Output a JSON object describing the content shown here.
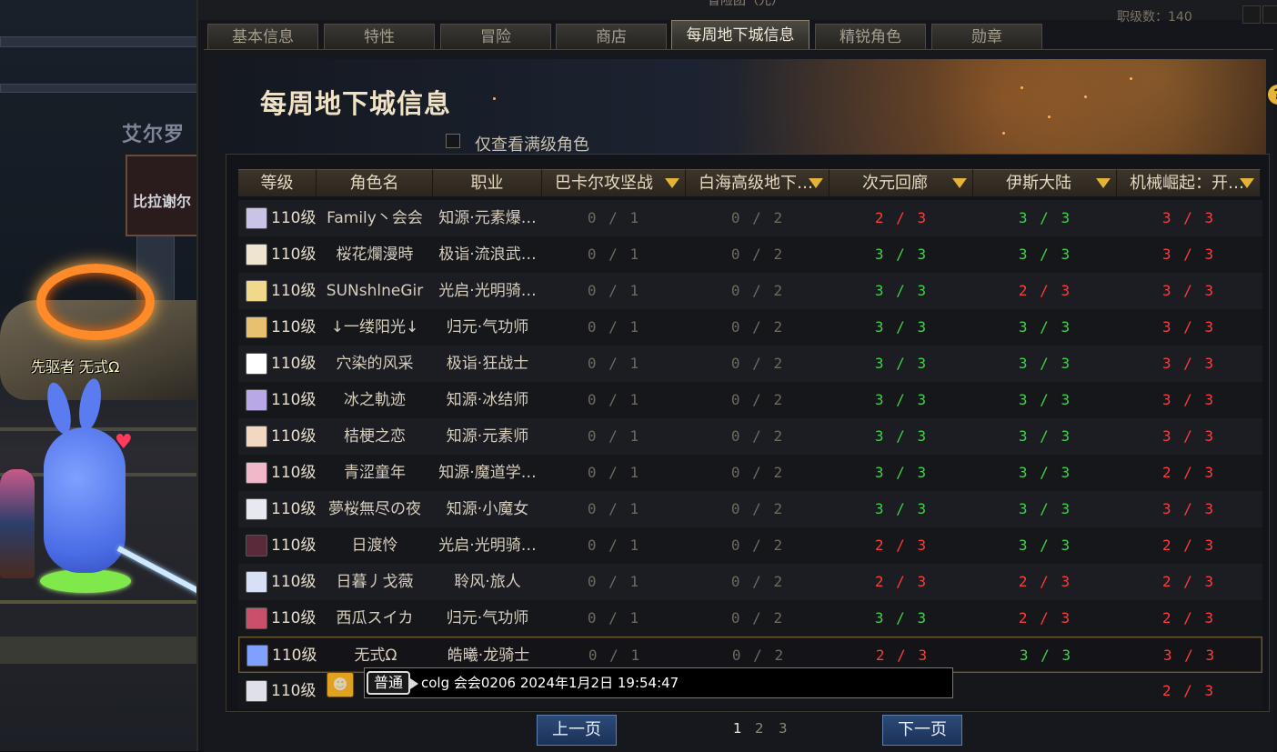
{
  "scene": {
    "wall_sign": "艾尔罗",
    "red_sign": "比拉谢尔",
    "player_name": "先驱者 无式Ω"
  },
  "window": {
    "title": "冒险团（光）",
    "counter": "职级数：140"
  },
  "tabs": [
    {
      "label": "基本信息"
    },
    {
      "label": "特性"
    },
    {
      "label": "冒险"
    },
    {
      "label": "商店"
    },
    {
      "label": "每周地下城信息",
      "active": true
    },
    {
      "label": "精锐角色"
    },
    {
      "label": "勋章"
    }
  ],
  "page": {
    "heading": "每周地下城信息",
    "filter_label": "仅查看满级角色",
    "help": "?"
  },
  "table": {
    "headers": {
      "level": "等级",
      "name": "角色名",
      "job": "职业",
      "d1": "巴卡尔攻坚战",
      "d2": "白海高级地下…",
      "d3": "次元回廊",
      "d4": "伊斯大陆",
      "d5": "机械崛起：开…"
    },
    "rows": [
      {
        "level": "110级",
        "name": "Family丶会会",
        "job": "知源·元素爆…",
        "d1": "0 / 1",
        "d2": "0 / 2",
        "d3": "2 / 3",
        "d4": "3 / 3",
        "d5": "3 / 3",
        "avatar": "#c9c3e8"
      },
      {
        "level": "110级",
        "name": "桜花爛漫時",
        "job": "极诣·流浪武…",
        "d1": "0 / 1",
        "d2": "0 / 2",
        "d3": "3 / 3",
        "d4": "3 / 3",
        "d5": "3 / 3",
        "avatar": "#efe4d0"
      },
      {
        "level": "110级",
        "name": "SUNshlneGir",
        "job": "光启·光明骑…",
        "d1": "0 / 1",
        "d2": "0 / 2",
        "d3": "3 / 3",
        "d4": "2 / 3",
        "d5": "3 / 3",
        "avatar": "#f1d88a"
      },
      {
        "level": "110级",
        "name": "↓一缕阳光↓",
        "job": "归元·气功师",
        "d1": "0 / 1",
        "d2": "0 / 2",
        "d3": "3 / 3",
        "d4": "3 / 3",
        "d5": "3 / 3",
        "avatar": "#e7c070"
      },
      {
        "level": "110级",
        "name": "穴染的风采",
        "job": "极诣·狂战士",
        "d1": "0 / 1",
        "d2": "0 / 2",
        "d3": "3 / 3",
        "d4": "3 / 3",
        "d5": "3 / 3",
        "avatar": "#ffffff"
      },
      {
        "level": "110级",
        "name": "冰之軌迹",
        "job": "知源·冰结师",
        "d1": "0 / 1",
        "d2": "0 / 2",
        "d3": "3 / 3",
        "d4": "3 / 3",
        "d5": "3 / 3",
        "avatar": "#b9a8e8"
      },
      {
        "level": "110级",
        "name": "桔梗之恋",
        "job": "知源·元素师",
        "d1": "0 / 1",
        "d2": "0 / 2",
        "d3": "3 / 3",
        "d4": "3 / 3",
        "d5": "3 / 3",
        "avatar": "#f2d8c0"
      },
      {
        "level": "110级",
        "name": "青涩童年",
        "job": "知源·魔道学…",
        "d1": "0 / 1",
        "d2": "0 / 2",
        "d3": "3 / 3",
        "d4": "3 / 3",
        "d5": "2 / 3",
        "avatar": "#f0b8c8"
      },
      {
        "level": "110级",
        "name": "夢桜無尽の夜",
        "job": "知源·小魔女",
        "d1": "0 / 1",
        "d2": "0 / 2",
        "d3": "3 / 3",
        "d4": "3 / 3",
        "d5": "3 / 3",
        "avatar": "#e8e8f0"
      },
      {
        "level": "110级",
        "name": "日渡怜",
        "job": "光启·光明骑…",
        "d1": "0 / 1",
        "d2": "0 / 2",
        "d3": "2 / 3",
        "d4": "3 / 3",
        "d5": "2 / 3",
        "avatar": "#5a2a3a"
      },
      {
        "level": "110级",
        "name": "日暮丿戈薇",
        "job": "聆风·旅人",
        "d1": "0 / 1",
        "d2": "0 / 2",
        "d3": "2 / 3",
        "d4": "2 / 3",
        "d5": "2 / 3",
        "avatar": "#d8e0f8"
      },
      {
        "level": "110级",
        "name": "西瓜スイカ",
        "job": "归元·气功师",
        "d1": "0 / 1",
        "d2": "0 / 2",
        "d3": "3 / 3",
        "d4": "2 / 3",
        "d5": "2 / 3",
        "avatar": "#c8506a"
      },
      {
        "level": "110级",
        "name": "无式Ω",
        "job": "皓曦·龙骑士",
        "d1": "0 / 1",
        "d2": "0 / 2",
        "d3": "2 / 3",
        "d4": "3 / 3",
        "d5": "3 / 3",
        "avatar": "#7fa0ff",
        "selected": true
      },
      {
        "level": "110级",
        "name": "",
        "job": "",
        "d1": "",
        "d2": "",
        "d3": "",
        "d4": "",
        "d5": "2 / 3",
        "avatar": "#e0e0e8"
      }
    ]
  },
  "chat": {
    "channel": "普通",
    "message": "colg 会会0206  2024年1月2日 19:54:47"
  },
  "pagination": {
    "prev": "上一页",
    "next": "下一页",
    "pages": [
      "1",
      "2",
      "3"
    ],
    "current": "1"
  },
  "colors": {
    "complete": "#3fd24a",
    "incomplete": "#ff3b3b",
    "muted": "#6f6a60",
    "accent": "#e2b43a"
  }
}
